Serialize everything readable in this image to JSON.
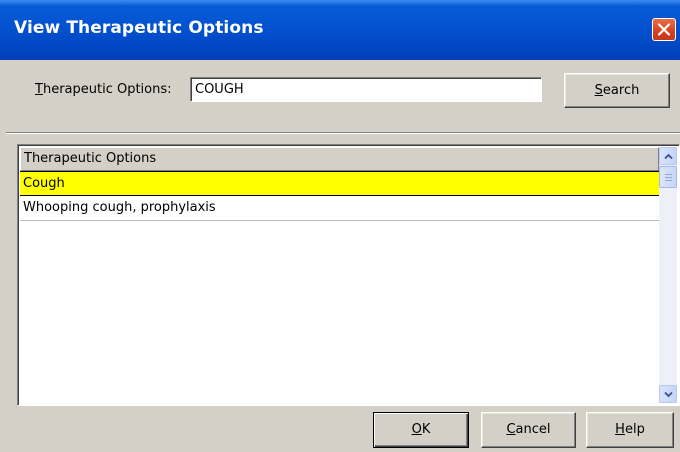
{
  "window": {
    "title": "View Therapeutic Options"
  },
  "search": {
    "label_accel": "T",
    "label_rest": "herapeutic Options:",
    "value": "COUGH",
    "button_accel": "S",
    "button_rest": "earch"
  },
  "list": {
    "column_header": "Therapeutic Options",
    "rows": [
      {
        "label": "Cough",
        "selected": true
      },
      {
        "label": "Whooping cough, prophylaxis",
        "selected": false
      }
    ],
    "selected_color": "#ffff00"
  },
  "buttons": {
    "ok_accel": "O",
    "ok_rest": "K",
    "cancel_accel": "C",
    "cancel_rest": "ancel",
    "help_accel": "H",
    "help_rest": "elp"
  },
  "icons": {
    "close": "close-icon",
    "scroll_up": "chevron-up-icon",
    "scroll_down": "chevron-down-icon"
  },
  "colors": {
    "titlebar": "#0455d2",
    "close_button": "#d8431e",
    "dialog_face": "#d4d0c8"
  }
}
